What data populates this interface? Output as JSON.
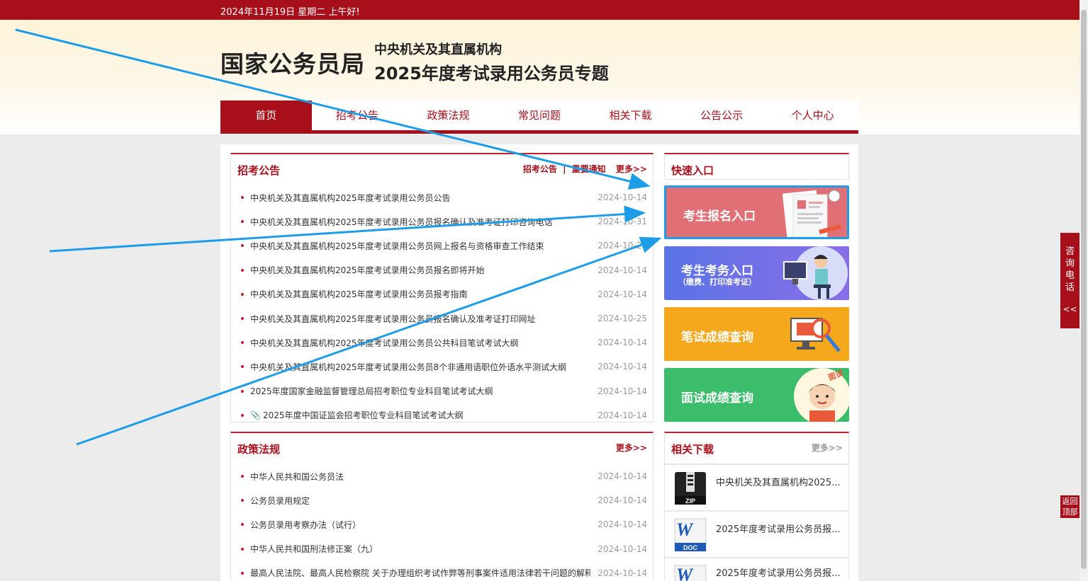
{
  "topbar": {
    "date_text": "2024年11月19日  星期二  上午好!"
  },
  "header": {
    "logo": "国家公务员局",
    "subtitle1": "中央机关及其直属机构",
    "subtitle2": "2025年度考试录用公务员专题"
  },
  "nav": {
    "items": [
      {
        "label": "首页"
      },
      {
        "label": "招考公告"
      },
      {
        "label": "政策法规"
      },
      {
        "label": "常见问题"
      },
      {
        "label": "相关下载"
      },
      {
        "label": "公告公示"
      },
      {
        "label": "个人中心"
      }
    ]
  },
  "announcements": {
    "title": "招考公告",
    "link1": "招考公告",
    "sep": "|",
    "link2": "重要通知",
    "more": "更多>>",
    "items": [
      {
        "title": "中央机关及其直属机构2025年度考试录用公务员公告",
        "date": "2024-10-14"
      },
      {
        "title": "中央机关及其直属机构2025年度考试录用公务员报名确认及准考证打印咨询电话",
        "date": "2024-10-31"
      },
      {
        "title": "中央机关及其直属机构2025年度考试录用公务员网上报名与资格审查工作结束",
        "date": "2024-10-26"
      },
      {
        "title": "中央机关及其直属机构2025年度考试录用公务员报名即将开始",
        "date": "2024-10-14"
      },
      {
        "title": "中央机关及其直属机构2025年度考试录用公务员报考指南",
        "date": "2024-10-14"
      },
      {
        "title": "中央机关及其直属机构2025年度考试录用公务员报名确认及准考证打印网址",
        "date": "2024-10-25"
      },
      {
        "title": "中央机关及其直属机构2025年度考试录用公务员公共科目笔试考试大纲",
        "date": "2024-10-14"
      },
      {
        "title": "中央机关及其直属机构2025年度考试录用公务员8个非通用语职位外语水平测试大纲",
        "date": "2024-10-14"
      },
      {
        "title": "2025年度国家金融监督管理总局招考职位专业科目笔试考试大纲",
        "date": "2024-10-14"
      },
      {
        "title": "2025年度中国证监会招考职位专业科目笔试考试大纲",
        "date": "2024-10-14"
      }
    ]
  },
  "policies": {
    "title": "政策法规",
    "more": "更多>>",
    "items": [
      {
        "title": "中华人民共和国公务员法",
        "date": "2024-10-14"
      },
      {
        "title": "公务员录用规定",
        "date": "2024-10-14"
      },
      {
        "title": "公务员录用考察办法（试行）",
        "date": "2024-10-14"
      },
      {
        "title": "中华人民共和国刑法修正案（九）",
        "date": "2024-10-14"
      },
      {
        "title": "最高人民法院、最高人民检察院 关于办理组织考试作弊等刑事案件适用法律若干问题的解释",
        "date": "2024-10-14"
      }
    ]
  },
  "quick": {
    "title": "快速入口",
    "cards": [
      {
        "label": "考生报名入口",
        "sublabel": ""
      },
      {
        "label": "考生考务入口",
        "sublabel": "（缴费、打印准考证）"
      },
      {
        "label": "笔试成绩查询",
        "sublabel": ""
      },
      {
        "label": "面试成绩查询",
        "sublabel": "面试"
      }
    ]
  },
  "downloads": {
    "title": "相关下载",
    "more": "更多>>",
    "items": [
      {
        "name": "中央机关及其直属机构2025...",
        "type": "ZIP"
      },
      {
        "name": "2025年度考试录用公务员报...",
        "type": "DOC"
      },
      {
        "name": "2025年度考试录用公务员报...",
        "type": "DOC"
      }
    ]
  },
  "side": {
    "consult": "咨询电话",
    "collapse": "<<",
    "back_top": "返回顶部"
  },
  "colors": {
    "brand": "#a7101b",
    "annotation_arrow": "#1d9ce8"
  }
}
